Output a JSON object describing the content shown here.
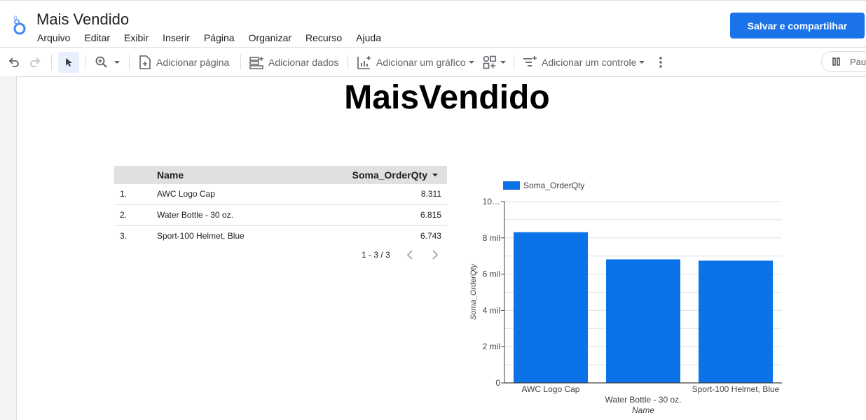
{
  "app": {
    "title": "Mais Vendido",
    "menu": [
      "Arquivo",
      "Editar",
      "Exibir",
      "Inserir",
      "Página",
      "Organizar",
      "Recurso",
      "Ajuda"
    ],
    "share_label": "Salvar e compartilhar"
  },
  "toolbar": {
    "add_page": "Adicionar página",
    "add_data": "Adicionar dados",
    "add_chart": "Adicionar um gráfico",
    "add_control": "Adicionar um controle",
    "pause_label": "Paus"
  },
  "report": {
    "title": "MaisVendido"
  },
  "table": {
    "headers": {
      "name": "Name",
      "value": "Soma_OrderQty"
    },
    "rows": [
      {
        "num": "1.",
        "name": "AWC Logo Cap",
        "value": "8.311"
      },
      {
        "num": "2.",
        "name": "Water Bottle - 30 oz.",
        "value": "6.815"
      },
      {
        "num": "3.",
        "name": "Sport-100 Helmet, Blue",
        "value": "6.743"
      }
    ],
    "pagination": "1 - 3 / 3"
  },
  "chart_data": {
    "type": "bar",
    "categories": [
      "AWC Logo Cap",
      "Water Bottle - 30 oz.",
      "Sport-100 Helmet, Blue"
    ],
    "series": [
      {
        "name": "Soma_OrderQty",
        "values": [
          8311,
          6815,
          6743
        ],
        "color": "#0b72e7"
      }
    ],
    "xlabel": "Name",
    "ylabel": "Soma_OrderQty",
    "ylim": [
      0,
      10000
    ],
    "yticks": [
      {
        "value": 0,
        "label": "0"
      },
      {
        "value": 2000,
        "label": "2 mil"
      },
      {
        "value": 4000,
        "label": "4 mil"
      },
      {
        "value": 6000,
        "label": "6 mil"
      },
      {
        "value": 8000,
        "label": "8 mil"
      },
      {
        "value": 10000,
        "label": "10…"
      }
    ],
    "legend_position": "top-left",
    "grid": true
  }
}
